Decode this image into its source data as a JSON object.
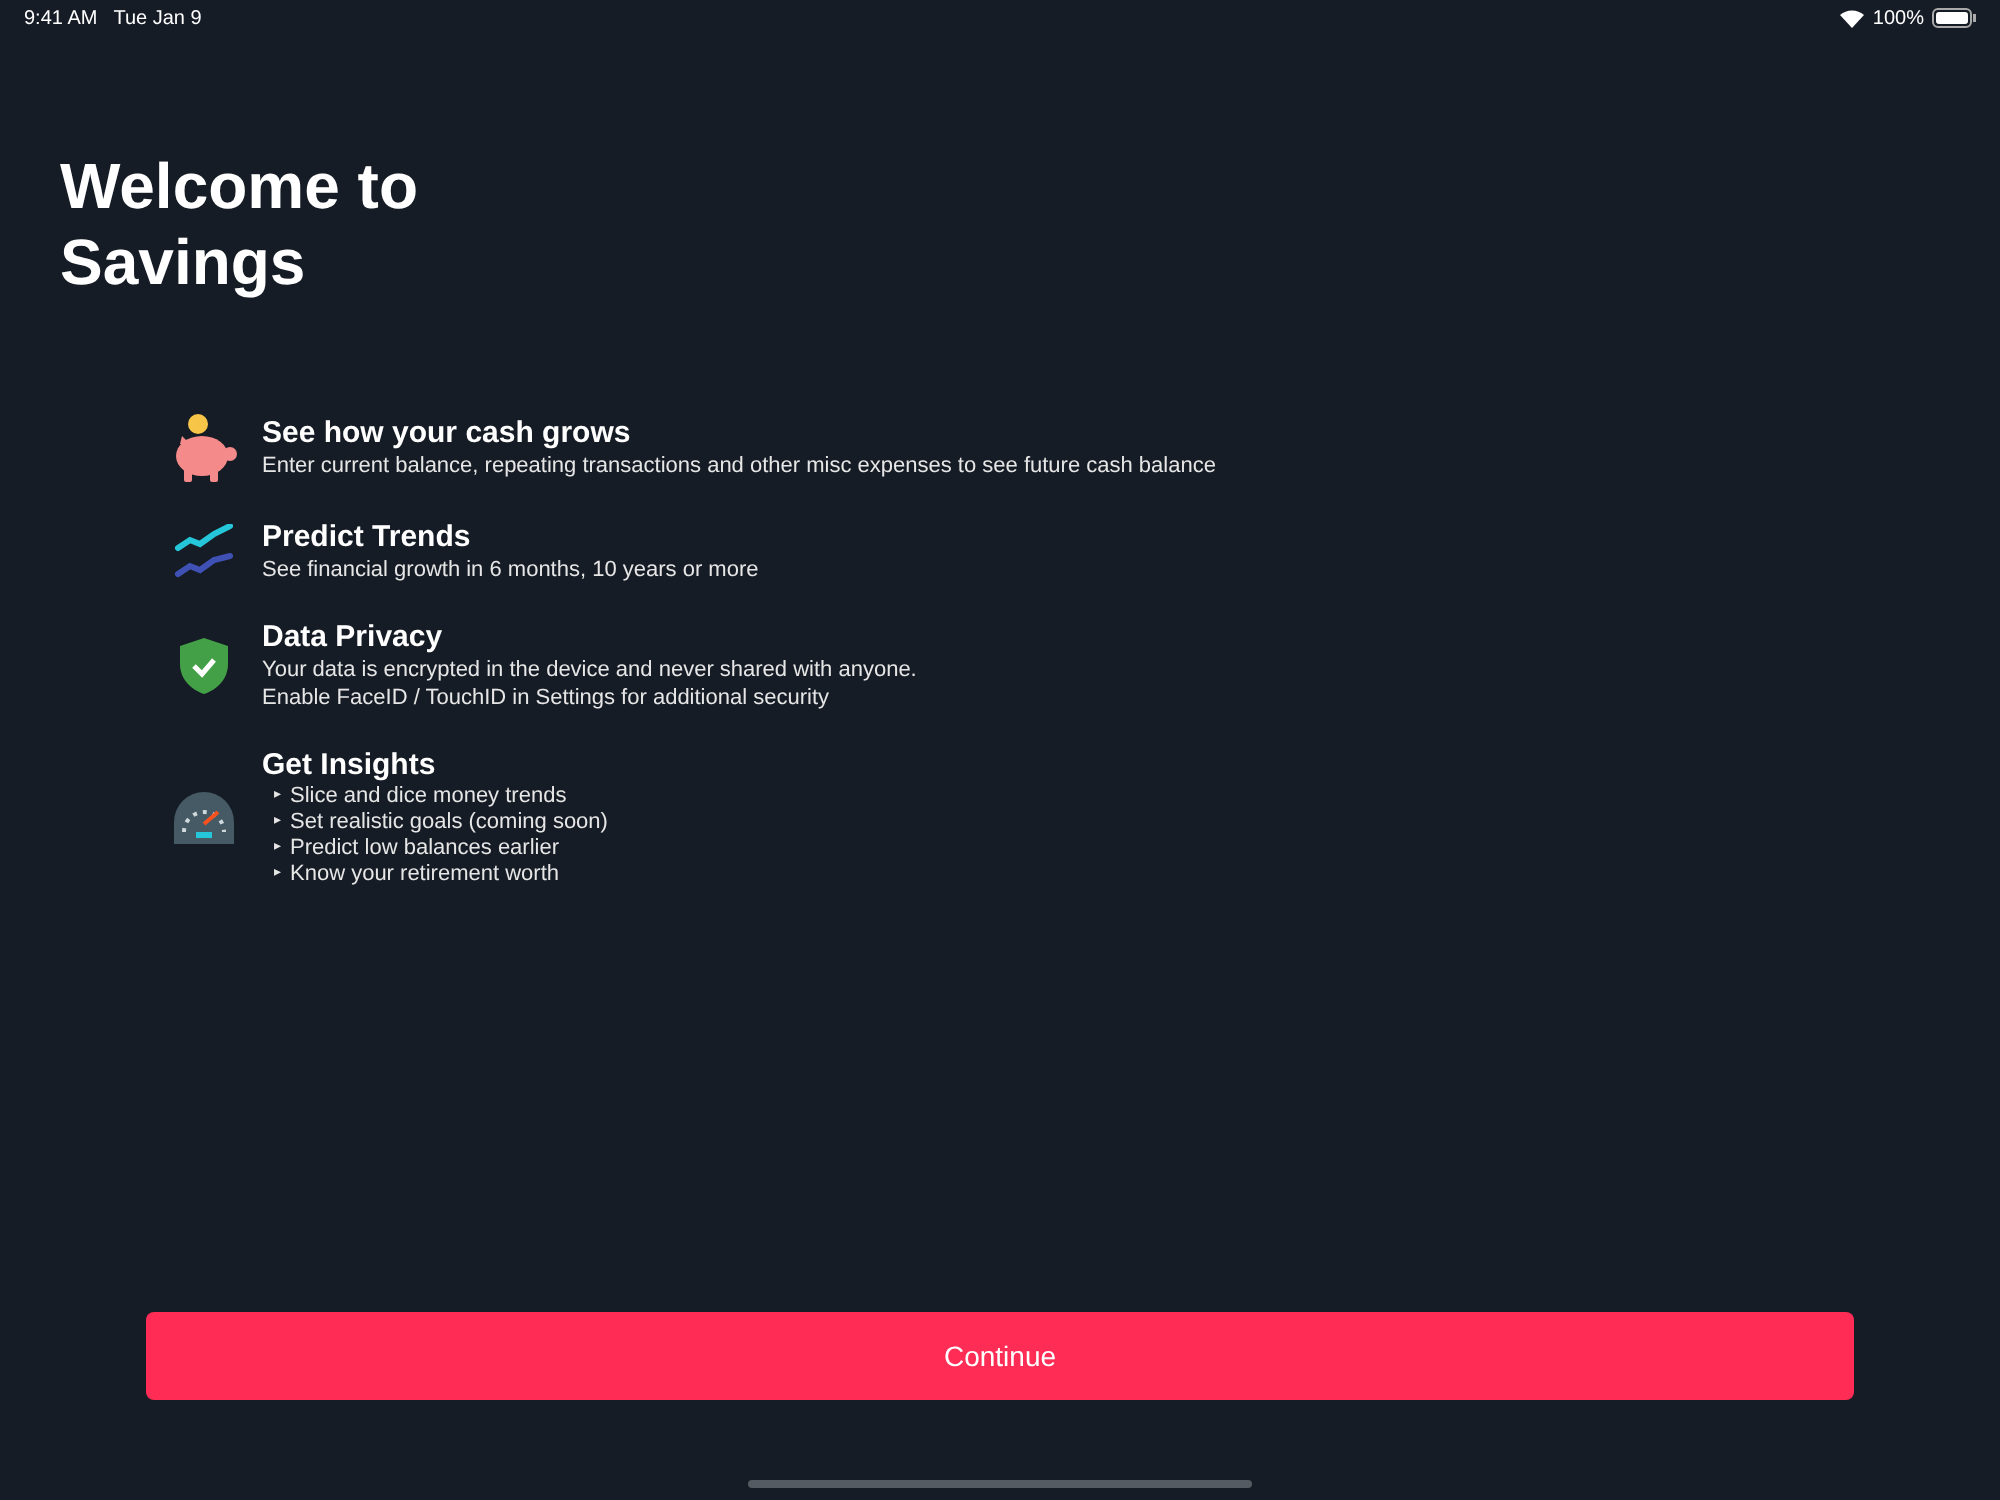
{
  "status_bar": {
    "time": "9:41 AM",
    "date": "Tue Jan 9",
    "battery": "100%"
  },
  "title": "Welcome to Savings",
  "features": [
    {
      "kind": "piggy",
      "title": "See how your cash grows",
      "lines": [
        "Enter current balance, repeating transactions and other misc expenses to see future cash balance"
      ]
    },
    {
      "kind": "trend",
      "title": "Predict Trends",
      "lines": [
        "See financial growth in 6 months, 10 years or more"
      ]
    },
    {
      "kind": "shield",
      "title": "Data Privacy",
      "lines": [
        "Your data is encrypted in the device and never shared with anyone.",
        "Enable FaceID / TouchID in Settings for additional security"
      ]
    },
    {
      "kind": "gauge",
      "title": "Get Insights",
      "bullets": [
        {
          "marker": "▸",
          "text": "Slice and dice money trends"
        },
        {
          "marker": "▸",
          "text": "Set realistic goals (coming soon)"
        },
        {
          "marker": "▸",
          "text": "Predict low balances earlier"
        },
        {
          "marker": "▸",
          "text": "Know your retirement worth"
        }
      ]
    }
  ],
  "continue_button": "Continue"
}
